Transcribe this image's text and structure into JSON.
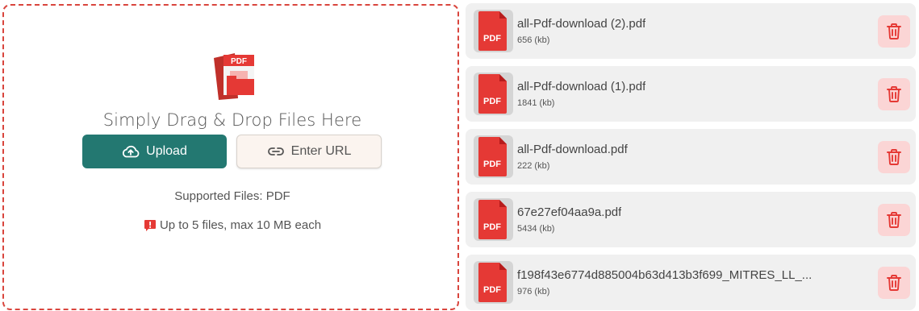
{
  "dropzone": {
    "title": "Simply Drag & Drop Files Here",
    "upload_label": "Upload",
    "url_label": "Enter URL",
    "supported": "Supported Files: PDF",
    "limit": "Up to 5 files, max 10 MB each",
    "logo_text": "PDF"
  },
  "files": [
    {
      "name": "all-Pdf-download (2).pdf",
      "size": "656 (kb)",
      "badge": "PDF"
    },
    {
      "name": "all-Pdf-download (1).pdf",
      "size": "1841 (kb)",
      "badge": "PDF"
    },
    {
      "name": "all-Pdf-download.pdf",
      "size": "222 (kb)",
      "badge": "PDF"
    },
    {
      "name": "67e27ef04aa9a.pdf",
      "size": "5434 (kb)",
      "badge": "PDF"
    },
    {
      "name": "f198f43e6774d885004b63d413b3f699_MITRES_LL_...",
      "size": "976 (kb)",
      "badge": "PDF"
    }
  ],
  "colors": {
    "accent": "#237871",
    "dashed_border": "#d9453d",
    "pdf_red": "#e53935",
    "delete_bg": "#fbd5d5",
    "delete_icon": "#e53935"
  },
  "icons": {
    "upload": "cloud-upload-icon",
    "url": "link-icon",
    "warning": "warning-icon",
    "delete": "trash-icon",
    "file": "pdf-file-icon"
  }
}
